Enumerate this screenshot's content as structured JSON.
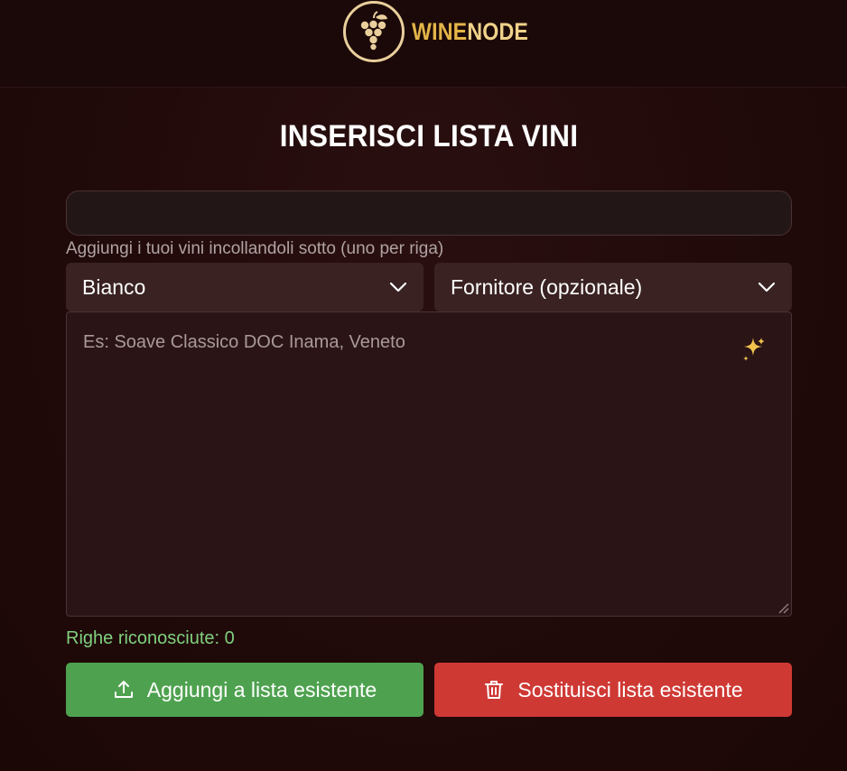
{
  "header": {
    "brand_part1": "WINE",
    "brand_part2": "NODE",
    "logo_icon": "grapes-icon"
  },
  "page": {
    "title": "INSERISCI LISTA VINI"
  },
  "form": {
    "name_value": "",
    "hint": "Aggiungi i tuoi vini incollandoli sotto (uno per riga)",
    "type_select": {
      "value": "Bianco",
      "icon": "chevron-down-icon"
    },
    "supplier_select": {
      "value": "Fornitore (opzionale)",
      "icon": "chevron-down-icon"
    },
    "wines_textarea": {
      "value": "",
      "placeholder": "Es: Soave Classico DOC Inama, Veneto",
      "icon": "sparkle-icon"
    },
    "recognized_text": "Righe riconosciute: 0"
  },
  "actions": {
    "add_label": "Aggiungi a lista esistente",
    "add_icon": "upload-icon",
    "replace_label": "Sostituisci lista esistente",
    "replace_icon": "trash-icon"
  },
  "colors": {
    "background": "#200909",
    "brand_gold": "#e3b448",
    "add_button": "#4ea24f",
    "replace_button": "#cf3934",
    "recognized_text": "#7fd17f"
  }
}
